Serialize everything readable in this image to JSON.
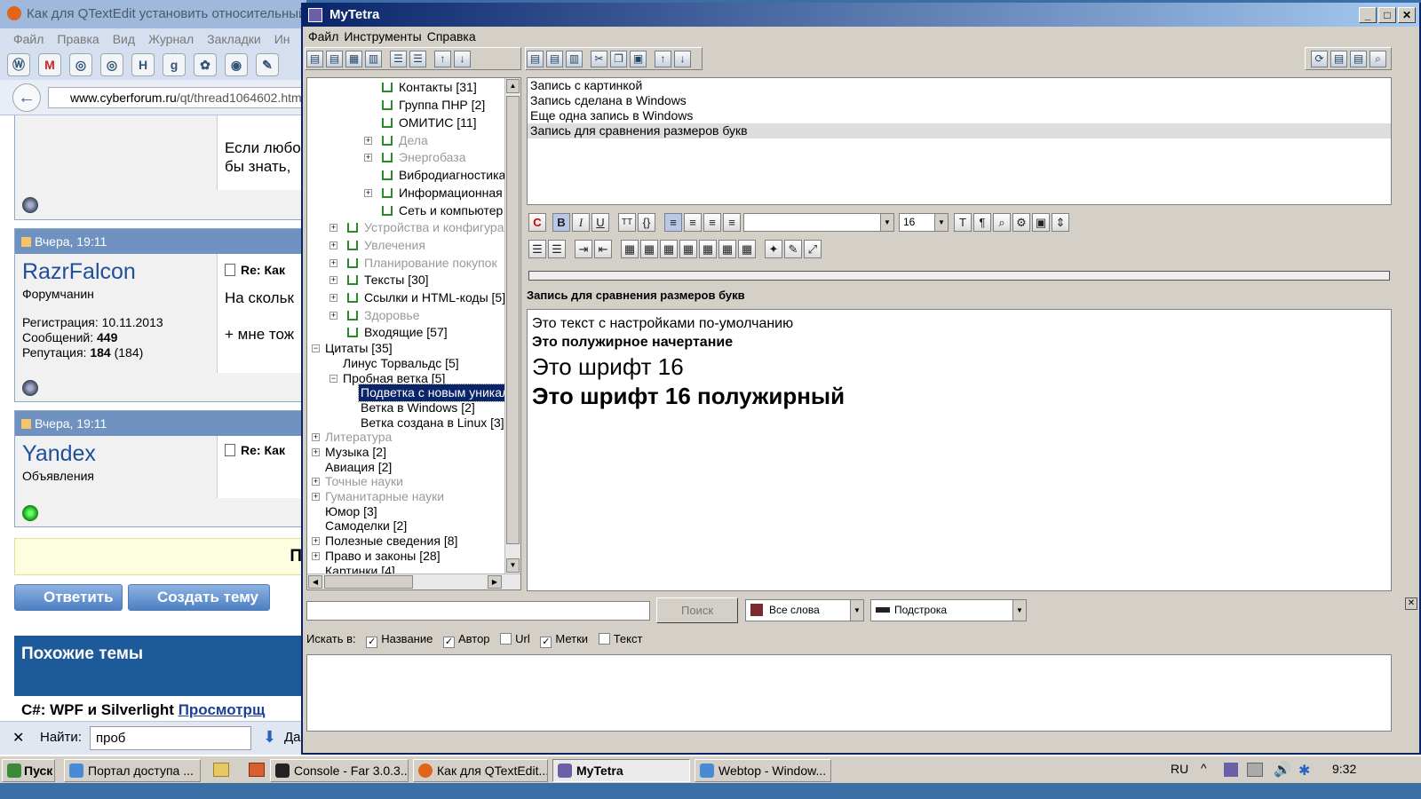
{
  "browser": {
    "title": "Как для QTextEdit установить относительный",
    "menu": [
      "Файл",
      "Правка",
      "Вид",
      "Журнал",
      "Закладки",
      "Ин"
    ],
    "url_host": "www.cyberforum.ru",
    "url_path": "/qt/thread1064602.htm",
    "post1_line1": "Если любо",
    "post1_line2": "бы знать,",
    "post2": {
      "header": "Вчера, 19:11",
      "username": "RazrFalcon",
      "role": "Форумчанин",
      "reg_label": "Регистрация:",
      "reg_value": "10.11.2013",
      "msgs_label": "Сообщений:",
      "msgs_value": "449",
      "rep_label": "Репутация:",
      "rep_value": "184",
      "rep_extra": "(184)",
      "subject": "Re: Как",
      "text1": "На скольк",
      "text2": "+ мне тож"
    },
    "post3": {
      "header": "Вчера, 19:11",
      "username": "Yandex",
      "role": "Объявления",
      "subject": "Re: Как"
    },
    "banner_letter": "П",
    "reply_button": "Ответить",
    "new_topic_button": "Создать тему",
    "similar_title": "Похожие темы",
    "similar_item_prefix": "C#: WPF и Silverlight",
    "similar_item_link": "Просмотрщ",
    "find_label": "Найти:",
    "find_value": "проб",
    "find_next": "Да"
  },
  "app": {
    "title": "MyTetra",
    "menu": [
      "Файл",
      "Инструменты",
      "Справка"
    ],
    "tree": [
      {
        "label": "Контакты [31]",
        "gray": false
      },
      {
        "label": "Группа ПНР [2]",
        "gray": false
      },
      {
        "label": "ОМИТИС [11]",
        "gray": false
      },
      {
        "label": "Дела",
        "gray": true
      },
      {
        "label": "Энергобаза",
        "gray": true
      },
      {
        "label": "Вибродиагностика",
        "gray": false
      },
      {
        "label": "Информационная",
        "gray": false
      },
      {
        "label": "Сеть и компьютер",
        "gray": false
      },
      {
        "label": "Устройства и конфигура",
        "gray": true
      },
      {
        "label": "Увлечения",
        "gray": true
      },
      {
        "label": "Планирование покупок",
        "gray": true
      },
      {
        "label": "Тексты [30]",
        "gray": false
      },
      {
        "label": "Ссылки и HTML-коды [5]",
        "gray": false
      },
      {
        "label": "Здоровье",
        "gray": true
      },
      {
        "label": "Входящие [57]",
        "gray": false
      },
      {
        "label": "Цитаты [35]",
        "gray": false
      },
      {
        "label": "Линус Торвальдс [5]",
        "gray": false
      },
      {
        "label": "Пробная ветка [5]",
        "gray": false
      },
      {
        "label": "Подветка с новым уникал",
        "gray": false
      },
      {
        "label": "Ветка в Windows [2]",
        "gray": false
      },
      {
        "label": "Ветка создана в Linux [3]",
        "gray": false
      },
      {
        "label": "Литература",
        "gray": true
      },
      {
        "label": "Музыка [2]",
        "gray": false
      },
      {
        "label": "Авиация [2]",
        "gray": false
      },
      {
        "label": "Точные науки",
        "gray": true
      },
      {
        "label": "Гуманитарные науки",
        "gray": true
      },
      {
        "label": "Юмор [3]",
        "gray": false
      },
      {
        "label": "Самоделки [2]",
        "gray": false
      },
      {
        "label": "Полезные сведения [8]",
        "gray": false
      },
      {
        "label": "Право и законы [28]",
        "gray": false
      },
      {
        "label": "Картинки [4]",
        "gray": false
      }
    ],
    "records": [
      "Запись с картинкой",
      "Запись сделана в Windows",
      "Еще одна запись в Windows",
      "Запись для сравнения размеров букв"
    ],
    "font_size": "16",
    "record_title": "Запись для сравнения размеров букв",
    "editor_lines": [
      "Это текст с настройками по-умолчанию",
      "Это полужирное начертание",
      "Это шрифт 16",
      "Это шрифт 16 полужирный"
    ],
    "search_button": "Поиск",
    "words_mode": "Все слова",
    "match_mode": "Подстрока",
    "search_in_label": "Искать в:",
    "search_fields": [
      {
        "label": "Название",
        "checked": "✓"
      },
      {
        "label": "Автор",
        "checked": "✓"
      },
      {
        "label": "Url",
        "checked": ""
      },
      {
        "label": "Метки",
        "checked": "✓"
      },
      {
        "label": "Текст",
        "checked": ""
      }
    ]
  },
  "taskbar": {
    "start": "Пуск",
    "items": [
      "Портал доступа ...",
      "Console - Far 3.0.3...",
      "Как для QTextEdit...",
      "MyTetra",
      "Webtop - Window..."
    ],
    "lang": "RU",
    "clock": "9:32"
  }
}
